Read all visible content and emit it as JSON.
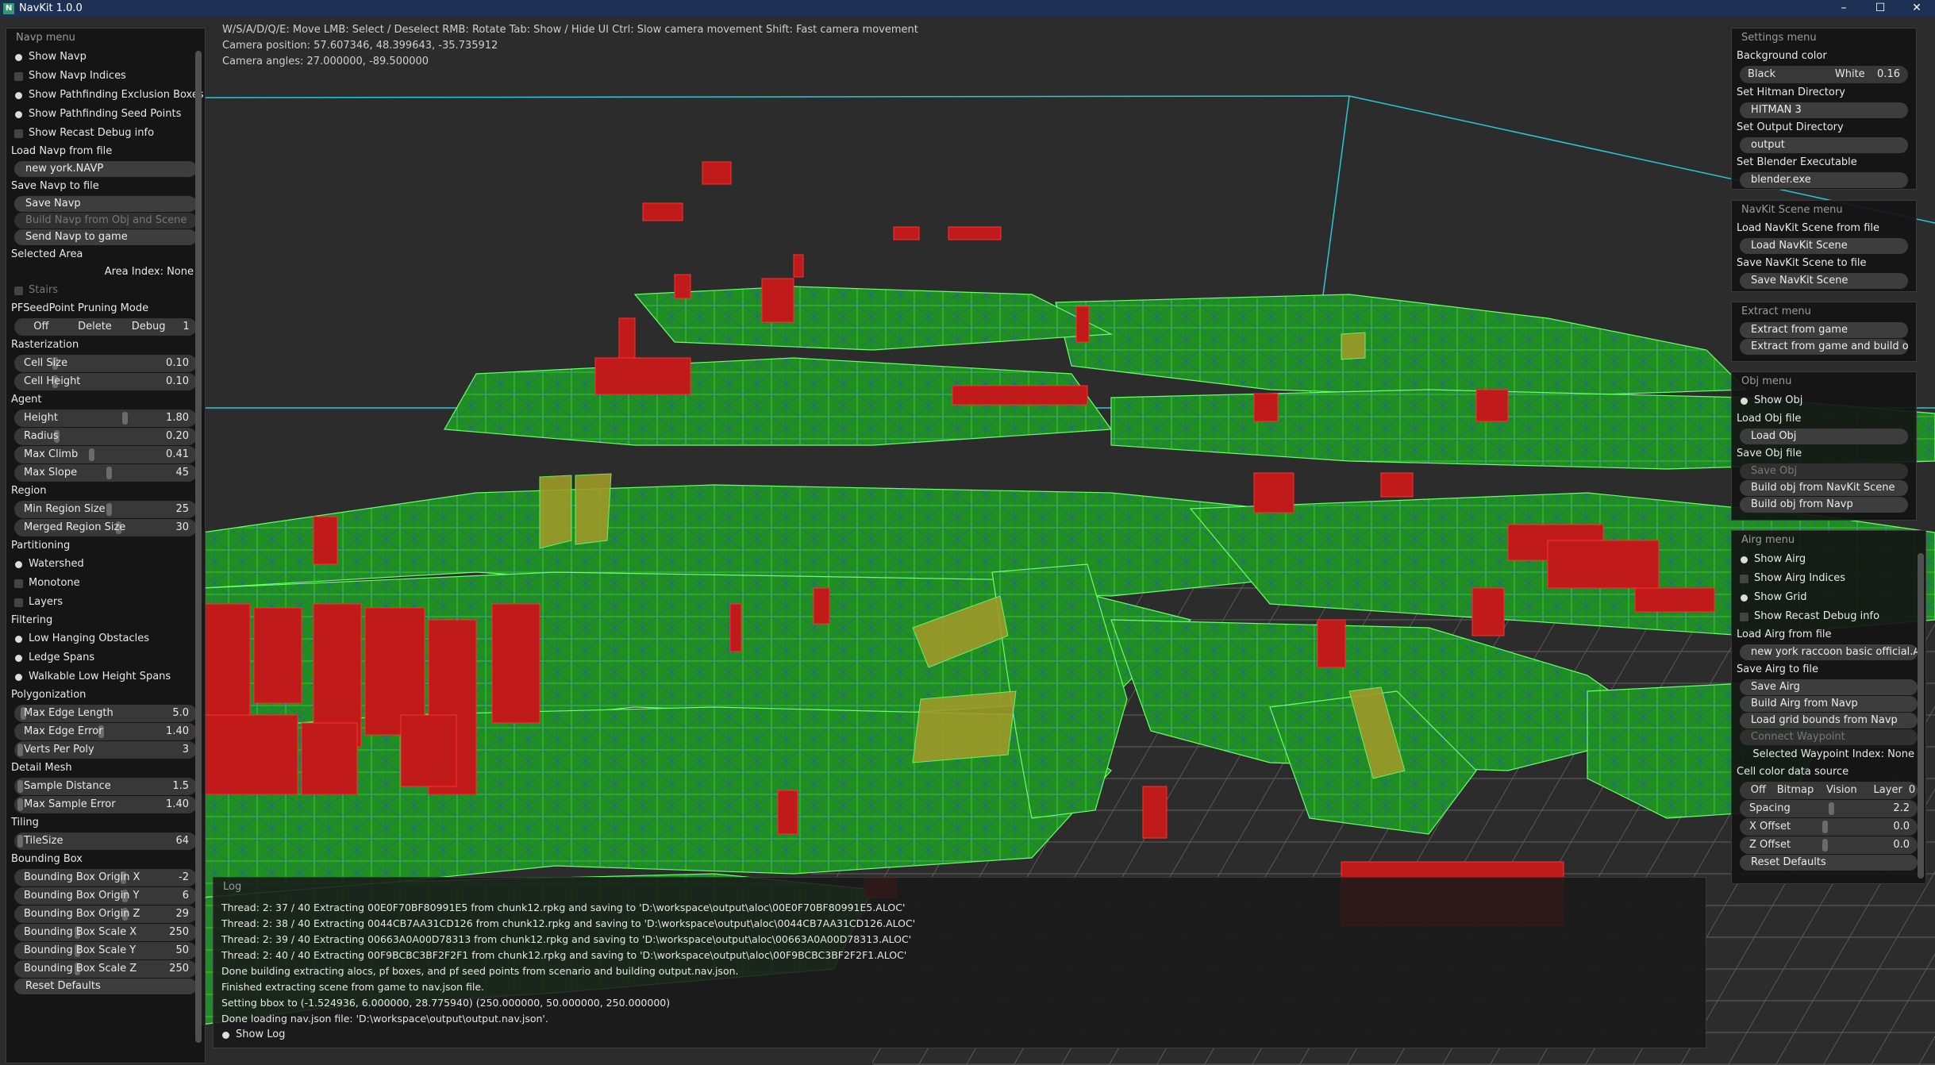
{
  "window": {
    "title": "NavKit 1.0.0",
    "minimize": "–",
    "maximize": "☐",
    "close": "✕"
  },
  "hud": {
    "controls": "W/S/A/D/Q/E: Move  LMB: Select / Deselect RMB: Rotate  Tab: Show / Hide UI  Ctrl: Slow camera movement  Shift: Fast camera movement",
    "camera_position": "Camera position: 57.607346, 48.399643, -35.735912",
    "camera_angles": "Camera angles: 27.000000, -89.500000"
  },
  "navp_menu": {
    "title": "Navp menu",
    "show_navp": "Show Navp",
    "show_navp_indices": "Show Navp Indices",
    "show_exclusion": "Show Pathfinding Exclusion Boxes",
    "show_seed": "Show Pathfinding Seed Points",
    "show_recast": "Show Recast Debug info",
    "load_label": "Load Navp from file",
    "load_value": "new york.NAVP",
    "save_label": "Save Navp to file",
    "save_btn": "Save Navp",
    "build_btn": "Build Navp from Obj and Scene",
    "send_btn": "Send Navp to game",
    "selected_area": "Selected Area",
    "area_index": "Area Index: None",
    "stairs": "Stairs",
    "pruning_label": "PFSeedPoint Pruning Mode",
    "pruning": [
      "Off",
      "Delete",
      "Debug",
      "1"
    ],
    "rasterization": "Rasterization",
    "cell_size": {
      "label": "Cell Size",
      "value": "0.10"
    },
    "cell_height": {
      "label": "Cell Height",
      "value": "0.10"
    },
    "agent": "Agent",
    "height": {
      "label": "Height",
      "value": "1.80"
    },
    "radius": {
      "label": "Radius",
      "value": "0.20"
    },
    "max_climb": {
      "label": "Max Climb",
      "value": "0.41"
    },
    "max_slope": {
      "label": "Max Slope",
      "value": "45"
    },
    "region": "Region",
    "min_region": {
      "label": "Min Region Size",
      "value": "25"
    },
    "merged_region": {
      "label": "Merged Region Size",
      "value": "30"
    },
    "partitioning": "Partitioning",
    "watershed": "Watershed",
    "monotone": "Monotone",
    "layers": "Layers",
    "filtering": "Filtering",
    "low_hanging": "Low Hanging Obstacles",
    "ledge": "Ledge Spans",
    "walkable_low": "Walkable Low Height Spans",
    "polygonization": "Polygonization",
    "max_edge_len": {
      "label": "Max Edge Length",
      "value": "5.0"
    },
    "max_edge_err": {
      "label": "Max Edge Error",
      "value": "1.40"
    },
    "verts_per_poly": {
      "label": "Verts Per Poly",
      "value": "3"
    },
    "detail_mesh": "Detail Mesh",
    "sample_dist": {
      "label": "Sample Distance",
      "value": "1.5"
    },
    "max_sample_err": {
      "label": "Max Sample Error",
      "value": "1.40"
    },
    "tiling": "Tiling",
    "tile_size": {
      "label": "TileSize",
      "value": "64"
    },
    "bounding_box": "Bounding Box",
    "bbox_ox": {
      "label": "Bounding Box Origin X",
      "value": "-2"
    },
    "bbox_oy": {
      "label": "Bounding Box Origin Y",
      "value": "6"
    },
    "bbox_oz": {
      "label": "Bounding Box Origin Z",
      "value": "29"
    },
    "bbox_sx": {
      "label": "Bounding Box Scale X",
      "value": "250"
    },
    "bbox_sy": {
      "label": "Bounding Box Scale Y",
      "value": "50"
    },
    "bbox_sz": {
      "label": "Bounding Box Scale Z",
      "value": "250"
    },
    "reset": "Reset Defaults"
  },
  "settings_menu": {
    "title": "Settings menu",
    "bg_label": "Background color",
    "bg_black": "Black",
    "bg_white": "White",
    "bg_value": "0.16",
    "hitman_label": "Set Hitman Directory",
    "hitman_value": "HITMAN 3",
    "output_label": "Set Output Directory",
    "output_value": "output",
    "blender_label": "Set Blender Executable",
    "blender_value": "blender.exe"
  },
  "scene_menu": {
    "title": "NavKit Scene menu",
    "load_label": "Load NavKit Scene from file",
    "load_btn": "Load NavKit Scene",
    "save_label": "Save NavKit Scene to file",
    "save_btn": "Save NavKit Scene"
  },
  "extract_menu": {
    "title": "Extract menu",
    "extract_btn": "Extract from game",
    "extract_build_btn": "Extract from game and build obj"
  },
  "obj_menu": {
    "title": "Obj menu",
    "show_obj": "Show Obj",
    "load_label": "Load Obj file",
    "load_btn": "Load Obj",
    "save_label": "Save Obj file",
    "save_btn": "Save Obj",
    "build_scene_btn": "Build obj from NavKit Scene",
    "build_navp_btn": "Build obj from Navp"
  },
  "airg_menu": {
    "title": "Airg menu",
    "show_airg": "Show Airg",
    "show_airg_indices": "Show Airg Indices",
    "show_grid": "Show Grid",
    "show_recast": "Show Recast Debug info",
    "load_label": "Load Airg from file",
    "load_value": "new york raccoon basic official.AIRG",
    "save_label": "Save Airg to file",
    "save_btn": "Save Airg",
    "build_btn": "Build Airg from Navp",
    "load_grid_btn": "Load grid bounds from Navp",
    "connect_btn": "Connect Waypoint",
    "selected_waypoint": "Selected Waypoint Index: None",
    "cell_color_label": "Cell color data source",
    "cell_color": [
      "Off",
      "Bitmap",
      "Vision Data",
      "Layer",
      "0"
    ],
    "spacing": {
      "label": "Spacing",
      "value": "2.2"
    },
    "x_offset": {
      "label": "X Offset",
      "value": "0.0"
    },
    "z_offset": {
      "label": "Z Offset",
      "value": "0.0"
    },
    "reset": "Reset Defaults"
  },
  "log": {
    "title": "Log",
    "lines": [
      "Thread: 2: 37 / 40 Extracting 00E0F70BF80991E5 from chunk12.rpkg and saving to 'D:\\workspace\\output\\aloc\\00E0F70BF80991E5.ALOC'",
      "Thread: 2: 38 / 40 Extracting 0044CB7AA31CD126 from chunk12.rpkg and saving to 'D:\\workspace\\output\\aloc\\0044CB7AA31CD126.ALOC'",
      "Thread: 2: 39 / 40 Extracting 00663A0A00D78313 from chunk12.rpkg and saving to 'D:\\workspace\\output\\aloc\\00663A0A00D78313.ALOC'",
      "Thread: 2: 40 / 40 Extracting 00F9BCBC3BF2F2F1 from chunk12.rpkg and saving to 'D:\\workspace\\output\\aloc\\00F9BCBC3BF2F2F1.ALOC'",
      "Done building extracting alocs, pf boxes, and pf seed points from scenario and building output.nav.json.",
      "Finished extracting scene from game to nav.json file.",
      "Setting bbox to (-1.524936, 6.000000, 28.775940) (250.000000, 50.000000, 250.000000)",
      "Done loading nav.json file: 'D:\\workspace\\output\\output.nav.json'."
    ],
    "show_log": "Show Log"
  }
}
